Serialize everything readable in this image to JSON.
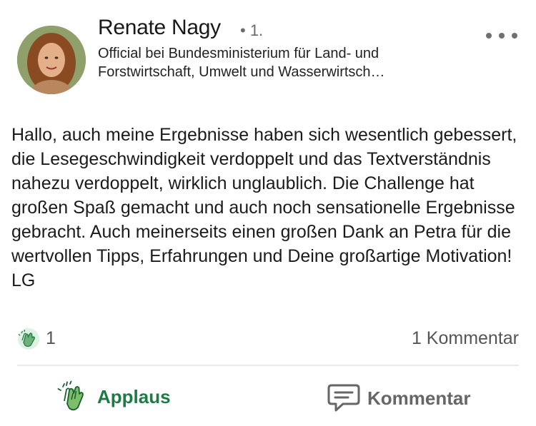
{
  "post": {
    "author": {
      "name": "Renate Nagy",
      "degree": "• 1.",
      "headline": "Official bei Bundesministerium für Land- und Forstwirtschaft, Umwelt und Wasserwirtsch…",
      "avatar": "profile-photo"
    },
    "menu_icon": "more-horizontal-icon",
    "body": "Hallo, auch meine Ergebnisse haben sich wesentlich gebessert, die Lesegeschwindigkeit verdoppelt und das Textverständnis nahezu verdoppelt, wirklich unglaublich. Die Challenge hat großen Spaß gemacht und auch noch sensationelle Ergebnisse gebracht. Auch meinerseits einen großen Dank an Petra für die wertvollen Tipps, Erfahrungen und Deine großartige Motivation! LG",
    "social": {
      "reaction_icon": "clapping-hands-icon",
      "reaction_count": "1",
      "comment_count": "1 Kommentar"
    },
    "actions": {
      "applause_label": "Applaus",
      "applause_icon": "clapping-hands-icon",
      "comment_label": "Kommentar",
      "comment_icon": "speech-bubble-icon"
    }
  },
  "colors": {
    "applause_green": "#1f7a45",
    "muted_gray": "#666666",
    "divider": "#e8e8e8"
  }
}
